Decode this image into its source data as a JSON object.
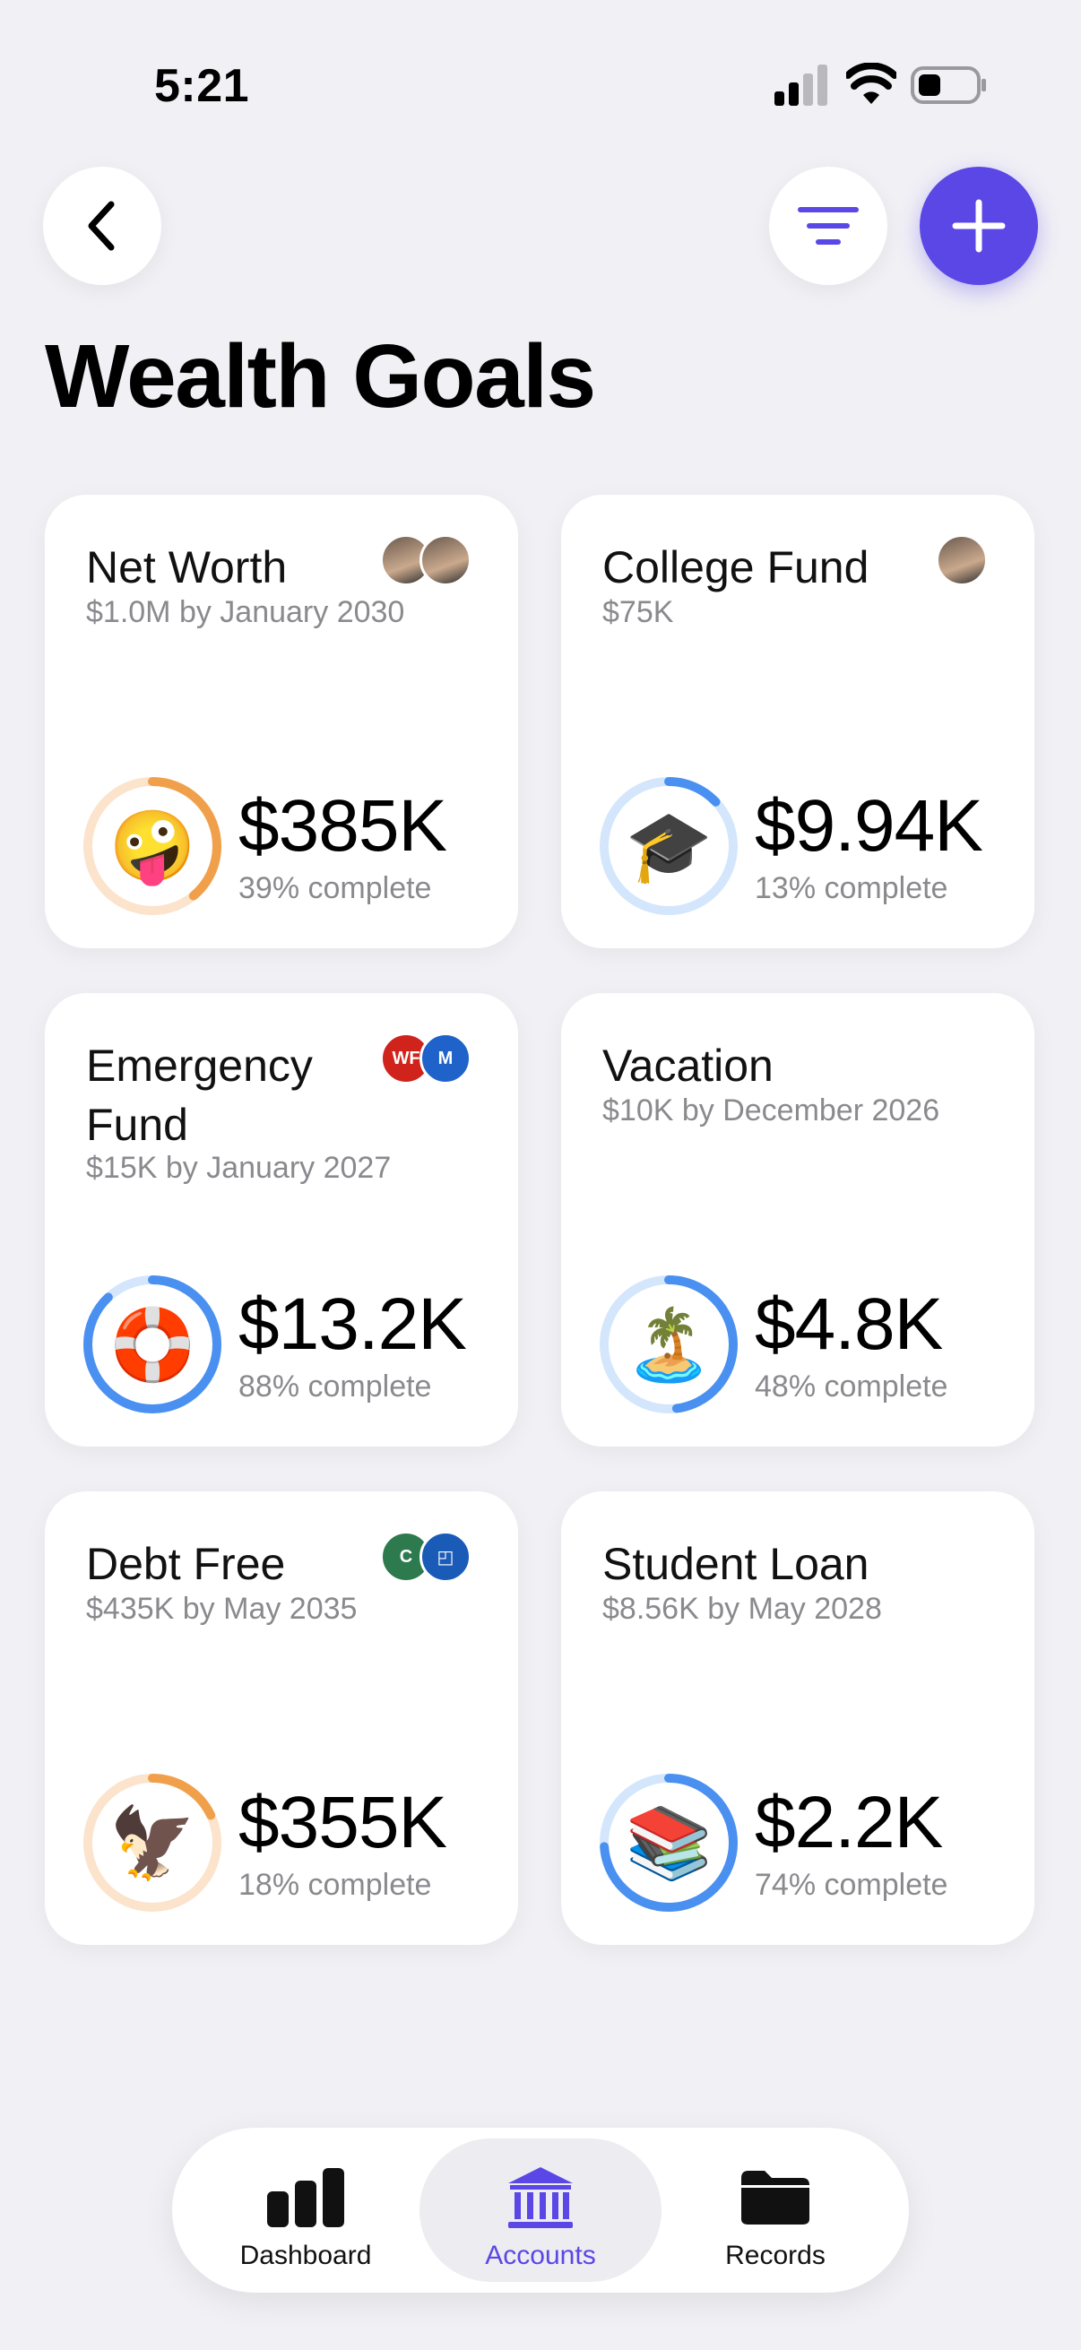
{
  "status_bar": {
    "time": "5:21"
  },
  "header": {
    "title": "Wealth Goals",
    "back_icon": "chevron-left-icon",
    "filter_icon": "filter-lines-icon",
    "add_icon": "plus-icon",
    "accent_color": "#5a47e6"
  },
  "goals": [
    {
      "title": "Net Worth",
      "subtitle": "$1.0M by January 2030",
      "amount": "$385K",
      "percent_text": "39% complete",
      "progress": 0.39,
      "emoji": "🤪",
      "ring_color": "#f0a04b",
      "ring_track": "#fbe3cc",
      "avatars": [
        "person-avatar",
        "person-avatar"
      ]
    },
    {
      "title": "College Fund",
      "subtitle": "$75K",
      "amount": "$9.94K",
      "percent_text": "13% complete",
      "progress": 0.13,
      "emoji": "🎓",
      "ring_color": "#4a90f0",
      "ring_track": "#d4e6fc",
      "avatars": [
        "person-avatar"
      ]
    },
    {
      "title": "Emergency Fund",
      "subtitle": "$15K by January 2027",
      "amount": "$13.2K",
      "percent_text": "88% complete",
      "progress": 0.88,
      "emoji": "🛟",
      "ring_color": "#4a90f0",
      "ring_track": "#d4e6fc",
      "avatars": [
        "bank-logo-wf",
        "bank-logo-bmo"
      ]
    },
    {
      "title": "Vacation",
      "subtitle": "$10K by December 2026",
      "amount": "$4.8K",
      "percent_text": "48% complete",
      "progress": 0.48,
      "emoji": "🏝️",
      "ring_color": "#4a90f0",
      "ring_track": "#d4e6fc",
      "avatars": []
    },
    {
      "title": "Debt Free",
      "subtitle": "$435K by May 2035",
      "amount": "$355K",
      "percent_text": "18% complete",
      "progress": 0.18,
      "emoji": "🦅",
      "ring_color": "#f0a04b",
      "ring_track": "#fbe3cc",
      "avatars": [
        "bank-logo-citizens",
        "bank-logo-chase"
      ]
    },
    {
      "title": "Student Loan",
      "subtitle": "$8.56K by May 2028",
      "amount": "$2.2K",
      "percent_text": "74% complete",
      "progress": 0.74,
      "emoji": "📚",
      "ring_color": "#4a90f0",
      "ring_track": "#d4e6fc",
      "avatars": []
    }
  ],
  "tabbar": {
    "tabs": [
      {
        "label": "Dashboard",
        "icon": "bar-chart-icon",
        "active": false
      },
      {
        "label": "Accounts",
        "icon": "bank-icon",
        "active": true
      },
      {
        "label": "Records",
        "icon": "folder-icon",
        "active": false
      }
    ]
  }
}
